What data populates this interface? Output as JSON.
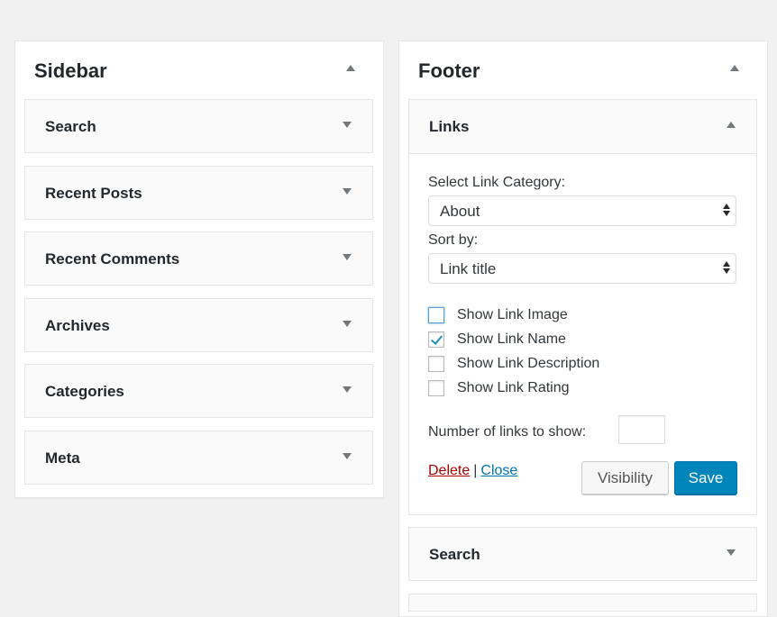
{
  "sidebar": {
    "title": "Sidebar",
    "widgets": [
      {
        "title": "Search"
      },
      {
        "title": "Recent Posts"
      },
      {
        "title": "Recent Comments"
      },
      {
        "title": "Archives"
      },
      {
        "title": "Categories"
      },
      {
        "title": "Meta"
      }
    ]
  },
  "footer": {
    "title": "Footer",
    "links_widget": {
      "title": "Links",
      "category_label": "Select Link Category:",
      "category_value": "About",
      "sort_label": "Sort by:",
      "sort_value": "Link title",
      "checkboxes": [
        {
          "label": "Show Link Image",
          "checked": false
        },
        {
          "label": "Show Link Name",
          "checked": true
        },
        {
          "label": "Show Link Description",
          "checked": false
        },
        {
          "label": "Show Link Rating",
          "checked": false
        }
      ],
      "number_label": "Number of links to show:",
      "number_value": "",
      "delete_label": "Delete",
      "separator": "|",
      "close_label": "Close",
      "visibility_label": "Visibility",
      "save_label": "Save"
    },
    "widgets": [
      {
        "title": "Search"
      }
    ]
  },
  "colors": {
    "primary_button": "#0085ba",
    "delete_link": "#a00",
    "close_link": "#0073aa",
    "background": "#f1f1f1"
  }
}
